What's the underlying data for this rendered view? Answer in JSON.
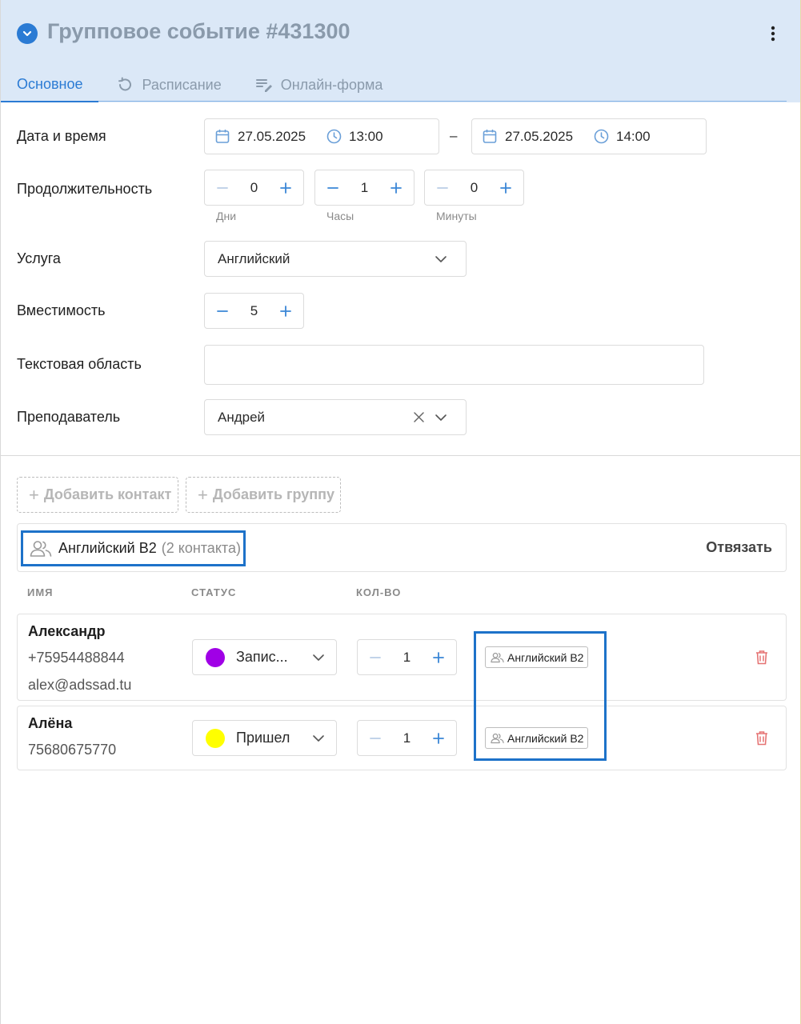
{
  "header": {
    "title": "Групповое событие #431300",
    "tabs": [
      {
        "label": "Основное",
        "active": true
      },
      {
        "label": "Расписание",
        "icon": "history-icon"
      },
      {
        "label": "Онлайн-форма",
        "icon": "form-edit-icon"
      }
    ]
  },
  "form": {
    "datetime": {
      "label": "Дата и время",
      "start_date": "27.05.2025",
      "start_time": "13:00",
      "separator": "–",
      "end_date": "27.05.2025",
      "end_time": "14:00"
    },
    "duration": {
      "label": "Продолжительность",
      "days": {
        "value": "0",
        "label": "Дни"
      },
      "hours": {
        "value": "1",
        "label": "Часы"
      },
      "minutes": {
        "value": "0",
        "label": "Минуты"
      }
    },
    "service": {
      "label": "Услуга",
      "value": "Английский"
    },
    "capacity": {
      "label": "Вместимость",
      "value": "5"
    },
    "textarea": {
      "label": "Текстовая область",
      "value": ""
    },
    "teacher": {
      "label": "Преподаватель",
      "value": "Андрей"
    }
  },
  "actions": {
    "add_contact": "Добавить контакт",
    "add_group": "Добавить группу"
  },
  "group": {
    "name": "Английский B2",
    "count": "(2 контакта)",
    "unlink": "Отвязать"
  },
  "table": {
    "headers": {
      "name": "ИМЯ",
      "status": "СТАТУС",
      "qty": "КОЛ-ВО"
    },
    "rows": [
      {
        "name": "Александр",
        "phone": "+75954488844",
        "email": "alex@adssad.tu",
        "status": "Запис...",
        "status_color": "#a000e6",
        "qty": "1",
        "group_tag": "Английский B2"
      },
      {
        "name": "Алёна",
        "phone": "75680675770",
        "status": "Пришел",
        "status_color": "#ffff00",
        "qty": "1",
        "group_tag": "Английский B2"
      }
    ]
  },
  "colors": {
    "accent": "#2b7bd4",
    "header_bg": "#dbe8f7",
    "danger": "#e57373",
    "highlight": "#1d72c9"
  }
}
